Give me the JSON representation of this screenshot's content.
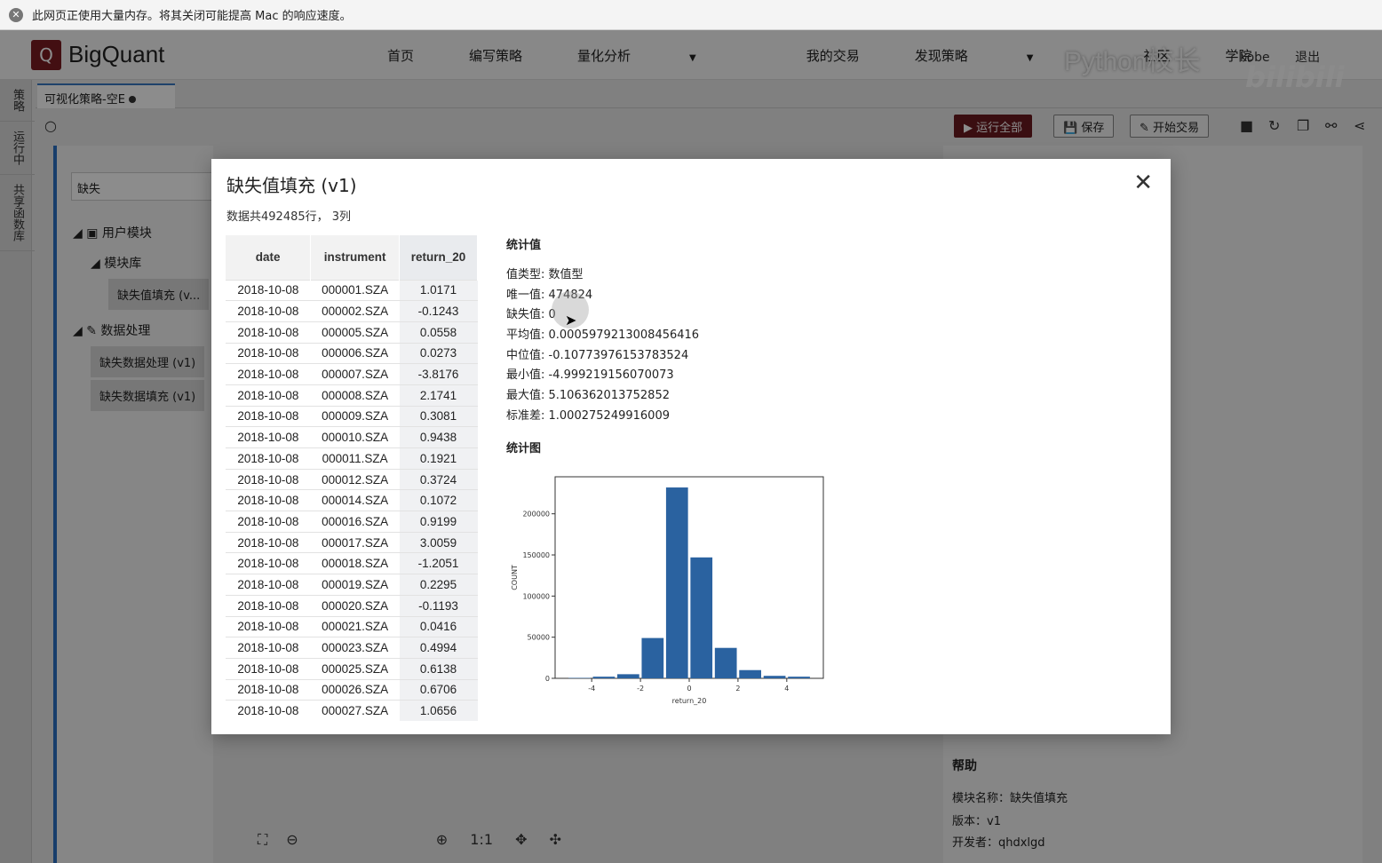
{
  "browser_warning": {
    "text": "此网页正使用大量内存。将其关闭可能提高 Mac 的响应速度。"
  },
  "app": {
    "brand": "BigQuant",
    "logo_letter": "Q",
    "nav": [
      "首页",
      "编写策略",
      "量化分析",
      "我的交易",
      "发现策略",
      "社区",
      "学院"
    ],
    "nav_dropdowns": [
      "量化分析",
      "发现策略"
    ],
    "watermark": "Python校长",
    "watermark2": "bilibili",
    "user": "kobe",
    "logout": "退出",
    "rail": [
      "策略",
      "运行中",
      "共享函数库"
    ],
    "tab_title": "可视化策略-空E",
    "toolbar": {
      "run_all": "运行全部",
      "save": "保存",
      "start_trade": "开始交易"
    },
    "search_value": "缺失",
    "tree": {
      "user_modules": "用户模块",
      "module_lib": "模块库",
      "module_leaf": "缺失值填充 (v...",
      "data_processing": "数据处理",
      "leaf1": "缺失数据处理 (v1)",
      "leaf2": "缺失数据填充 (v1)"
    },
    "help": {
      "title": "帮助",
      "name": "模块名称：缺失值填充",
      "version": "版本：v1",
      "developer": "开发者：qhdxlgd"
    }
  },
  "modal": {
    "title": "缺失值填充 (v1)",
    "subtitle": "数据共492485行， 3列",
    "table": {
      "headers": [
        "date",
        "instrument",
        "return_20"
      ],
      "rows": [
        [
          "2018-10-08",
          "000001.SZA",
          "1.0171"
        ],
        [
          "2018-10-08",
          "000002.SZA",
          "-0.1243"
        ],
        [
          "2018-10-08",
          "000005.SZA",
          "0.0558"
        ],
        [
          "2018-10-08",
          "000006.SZA",
          "0.0273"
        ],
        [
          "2018-10-08",
          "000007.SZA",
          "-3.8176"
        ],
        [
          "2018-10-08",
          "000008.SZA",
          "2.1741"
        ],
        [
          "2018-10-08",
          "000009.SZA",
          "0.3081"
        ],
        [
          "2018-10-08",
          "000010.SZA",
          "0.9438"
        ],
        [
          "2018-10-08",
          "000011.SZA",
          "0.1921"
        ],
        [
          "2018-10-08",
          "000012.SZA",
          "0.3724"
        ],
        [
          "2018-10-08",
          "000014.SZA",
          "0.1072"
        ],
        [
          "2018-10-08",
          "000016.SZA",
          "0.9199"
        ],
        [
          "2018-10-08",
          "000017.SZA",
          "3.0059"
        ],
        [
          "2018-10-08",
          "000018.SZA",
          "-1.2051"
        ],
        [
          "2018-10-08",
          "000019.SZA",
          "0.2295"
        ],
        [
          "2018-10-08",
          "000020.SZA",
          "-0.1193"
        ],
        [
          "2018-10-08",
          "000021.SZA",
          "0.0416"
        ],
        [
          "2018-10-08",
          "000023.SZA",
          "0.4994"
        ],
        [
          "2018-10-08",
          "000025.SZA",
          "0.6138"
        ],
        [
          "2018-10-08",
          "000026.SZA",
          "0.6706"
        ],
        [
          "2018-10-08",
          "000027.SZA",
          "1.0656"
        ]
      ]
    },
    "stats": {
      "heading": "统计值",
      "lines": [
        "值类型: 数值型",
        "唯一值: 474824",
        "缺失值: 0",
        "平均值: 0.0005979213008456416",
        "中位值: -0.10773976153783524",
        "最小值: -4.999219156070073",
        "最大值: 5.106362013752852",
        "标准差: 1.000275249916009"
      ],
      "chart_heading": "统计图"
    }
  },
  "chart_data": {
    "type": "bar",
    "title": "",
    "xlabel": "return_20",
    "ylabel": "COUNT",
    "bin_centers": [
      -4.5,
      -3.5,
      -2.5,
      -1.5,
      -0.5,
      0.5,
      1.5,
      2.5,
      3.5,
      4.5
    ],
    "values": [
      500,
      2000,
      5000,
      49000,
      232000,
      147000,
      37000,
      10000,
      3000,
      2000
    ],
    "xlim": [
      -5.5,
      5.5
    ],
    "ylim": [
      0,
      245000
    ],
    "xticks": [
      -4,
      -2,
      0,
      2,
      4
    ],
    "xtick_labels": [
      "-4",
      "-2",
      "0",
      "2",
      "4"
    ],
    "yticks": [
      0,
      50000,
      100000,
      150000,
      200000
    ],
    "ytick_labels": [
      "0",
      "50000",
      "100000",
      "150000",
      "200000"
    ],
    "bar_color": "#2a62a0"
  }
}
